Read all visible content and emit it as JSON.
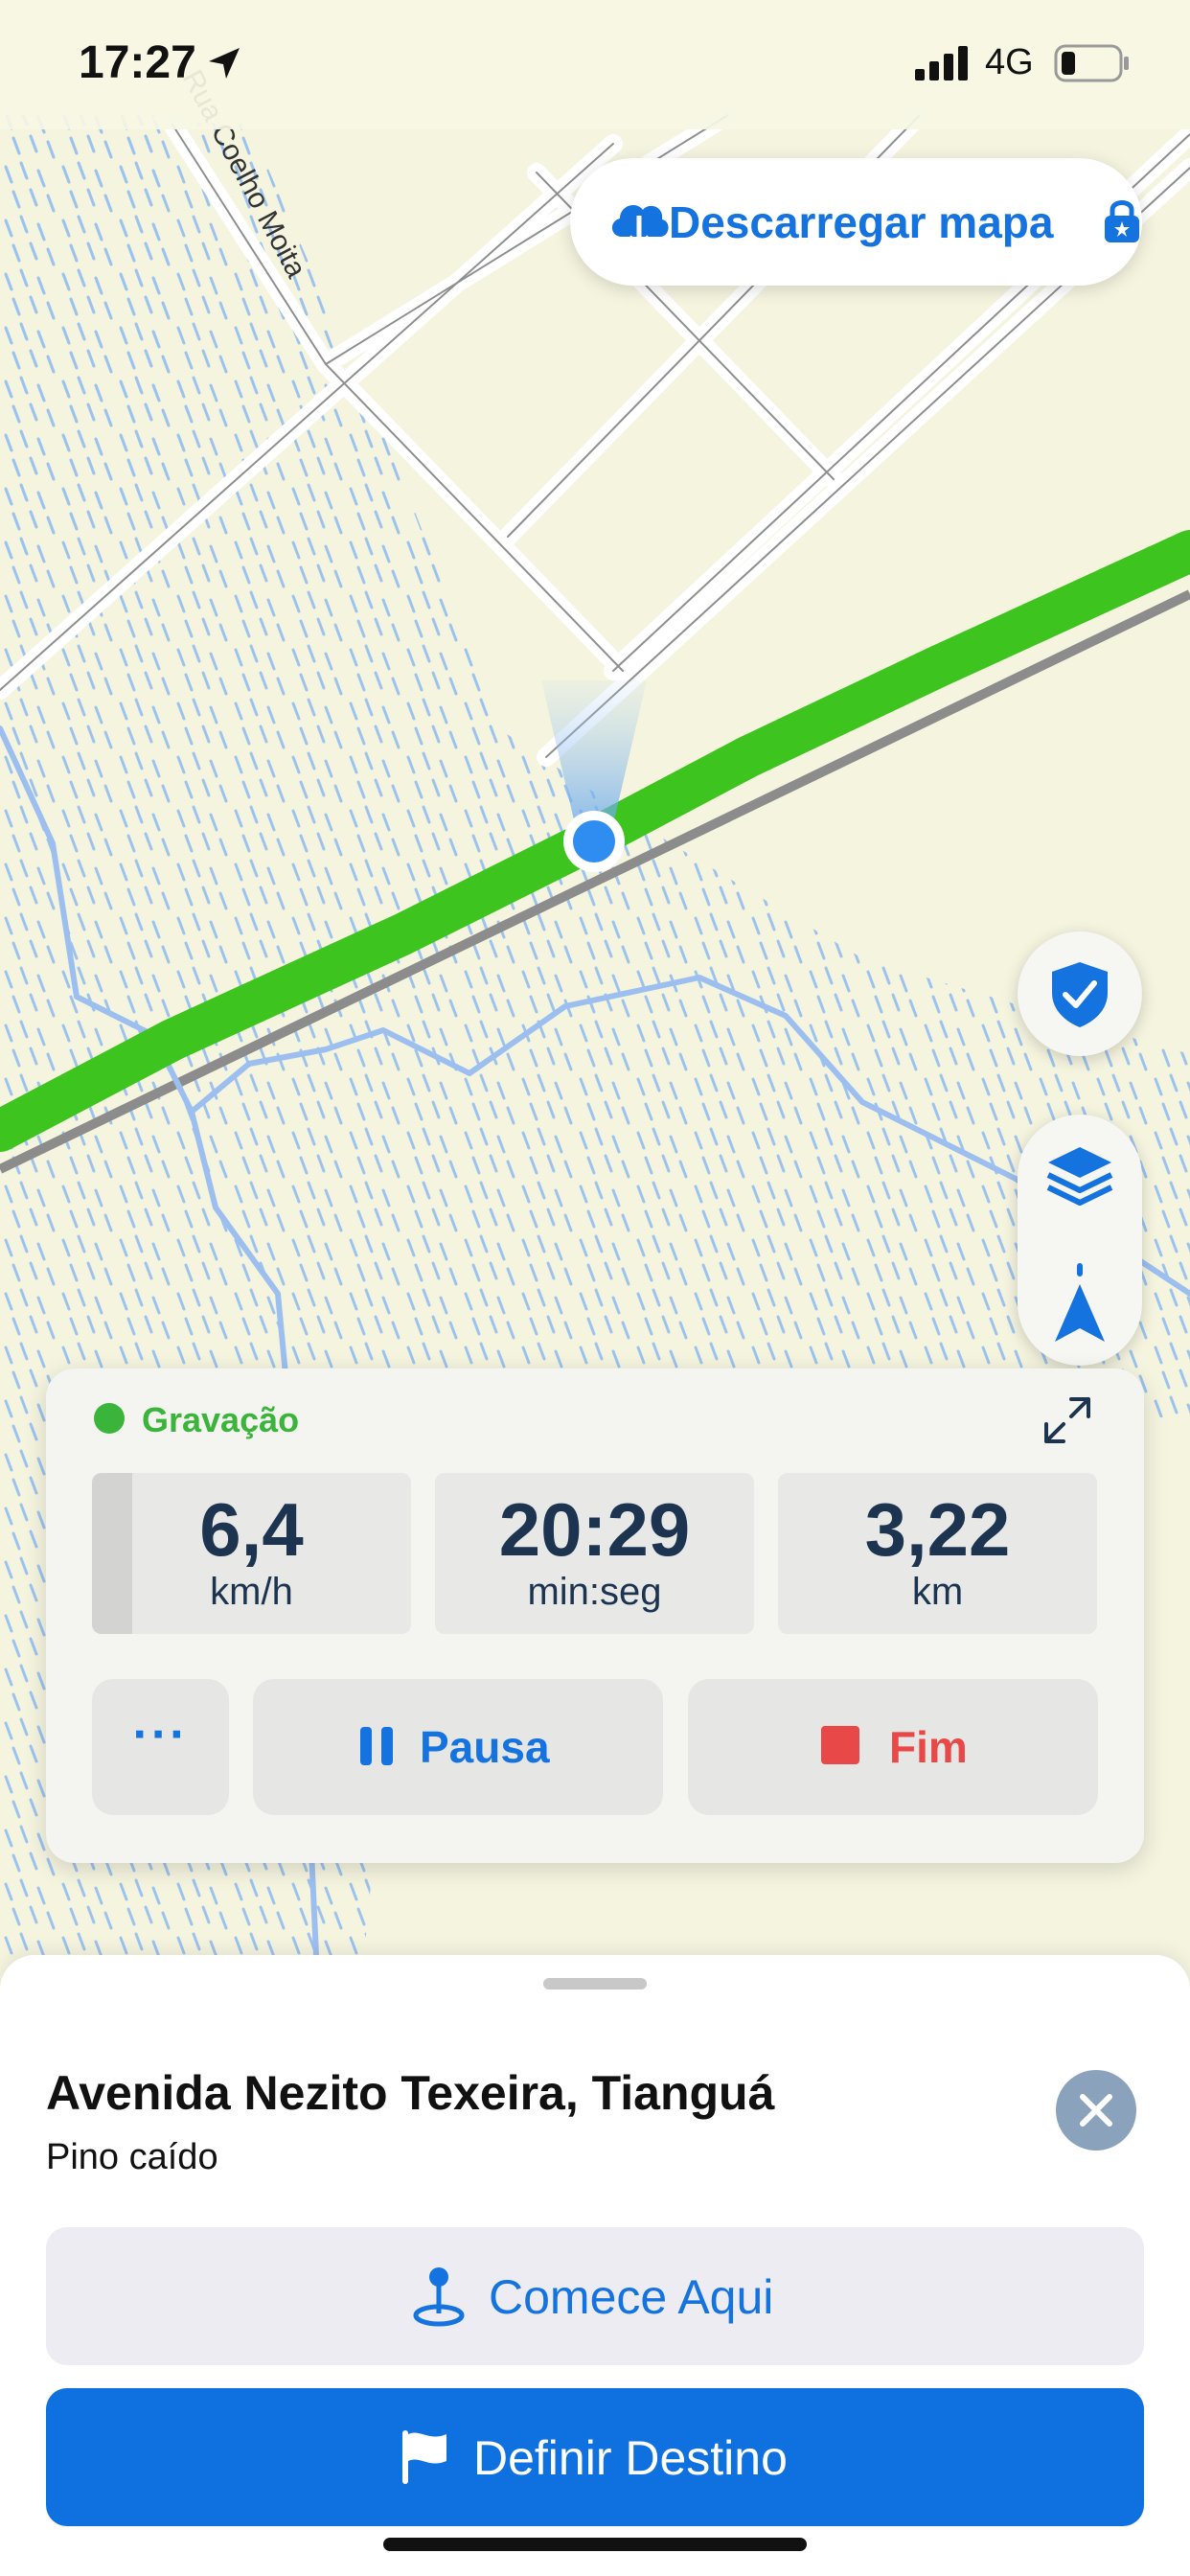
{
  "status_bar": {
    "time": "17:27",
    "network": "4G",
    "icons": [
      "location-arrow-icon",
      "signal-bars-icon",
      "battery-icon"
    ]
  },
  "map": {
    "street_label": "Rua Coelho Moita",
    "download_button": {
      "label": "Descarregar mapa",
      "icon": "cloud-download-icon",
      "badge_icon": "lock-icon"
    }
  },
  "controls": {
    "shield_icon": "shield-check-icon",
    "layers_icon": "layers-icon",
    "navigate_icon": "navigation-arrow-icon"
  },
  "recording": {
    "status": "Gravação",
    "status_color": "#3bb43b",
    "stats": [
      {
        "value": "6,4",
        "unit": "km/h"
      },
      {
        "value": "20:29",
        "unit": "min:seg"
      },
      {
        "value": "3,22",
        "unit": "km"
      }
    ],
    "more_label": "···",
    "pause_label": "Pausa",
    "stop_label": "Fim"
  },
  "place": {
    "title": "Avenida Nezito Texeira, Tianguá",
    "subtitle": "Pino caído",
    "start_label": "Comece Aqui",
    "destination_label": "Definir Destino"
  },
  "colors": {
    "accent": "#1573e0",
    "track": "#3ec41e",
    "stop": "#e84848",
    "map_bg": "#f4f4df",
    "water": "#9dc0f0"
  }
}
